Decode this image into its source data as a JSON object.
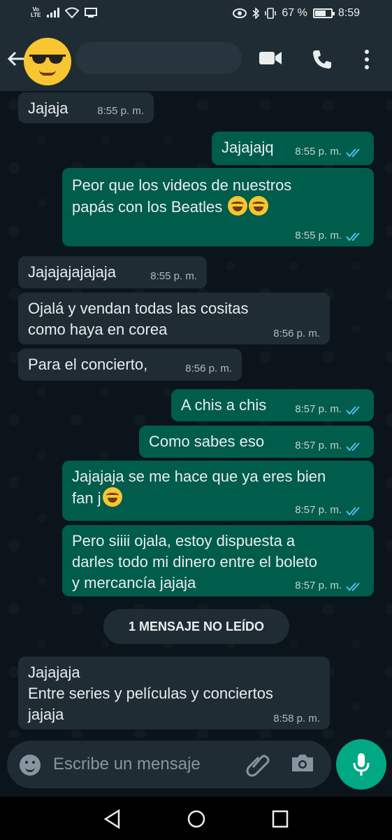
{
  "status_bar": {
    "volte_top": "Vo",
    "volte_bottom": "LTE",
    "battery_percent": "67 %",
    "battery_level": 0.67,
    "time": "8:59"
  },
  "header": {
    "contact_name": ""
  },
  "messages": [
    {
      "dir": "in",
      "text": "Jajaja",
      "time": "8:55 p. m."
    },
    {
      "dir": "out",
      "text": "Jajajajq",
      "time": "8:55 p. m.",
      "ticks": "read"
    },
    {
      "dir": "out",
      "text_line1": "Peor que los videos de nuestros",
      "text_line2": "papás con los Beatles",
      "emoji_count": 2,
      "time": "8:55 p. m.",
      "ticks": "read"
    },
    {
      "dir": "in",
      "text": "Jajajajajajaja",
      "time": "8:55 p. m."
    },
    {
      "dir": "in",
      "text_line1": "Ojalá y vendan todas las cositas",
      "text_line2": "como haya en corea",
      "time": "8:56 p. m."
    },
    {
      "dir": "in",
      "text": "Para el concierto,",
      "time": "8:56 p. m."
    },
    {
      "dir": "out",
      "text": "A chis a chis",
      "time": "8:57 p. m.",
      "ticks": "read"
    },
    {
      "dir": "out",
      "text": "Como sabes eso",
      "time": "8:57 p. m.",
      "ticks": "read"
    },
    {
      "dir": "out",
      "text_line1": "Jajajaja se me hace que ya eres bien",
      "text_line2": "fan j",
      "emoji_count": 1,
      "time": "8:57 p. m.",
      "ticks": "read"
    },
    {
      "dir": "out",
      "text_line1": "Pero siiii ojala, estoy dispuesta a",
      "text_line2": "darles todo mi dinero entre el boleto",
      "text_line3": "y mercancía jajaja",
      "time": "8:57 p. m.",
      "ticks": "read"
    },
    {
      "dir": "in",
      "text_line1": "Jajajaja",
      "text_line2": "Entre series y películas y conciertos",
      "text_line3": "jajaja",
      "time": "8:58 p. m."
    }
  ],
  "unread_divider": "1 MENSAJE NO LEÍDO",
  "input": {
    "placeholder": "Escribe un mensaje"
  },
  "colors": {
    "background": "#0b141a",
    "incoming_bubble": "#1f2c34",
    "outgoing_bubble": "#005c4b",
    "accent": "#00a884",
    "read_ticks": "#53bdeb"
  },
  "icons": {
    "back": "arrow-left-icon",
    "video": "video-call-icon",
    "call": "phone-icon",
    "menu": "more-vertical-icon",
    "emoji": "emoji-icon",
    "attach": "paperclip-icon",
    "camera": "camera-icon",
    "mic": "microphone-icon"
  }
}
